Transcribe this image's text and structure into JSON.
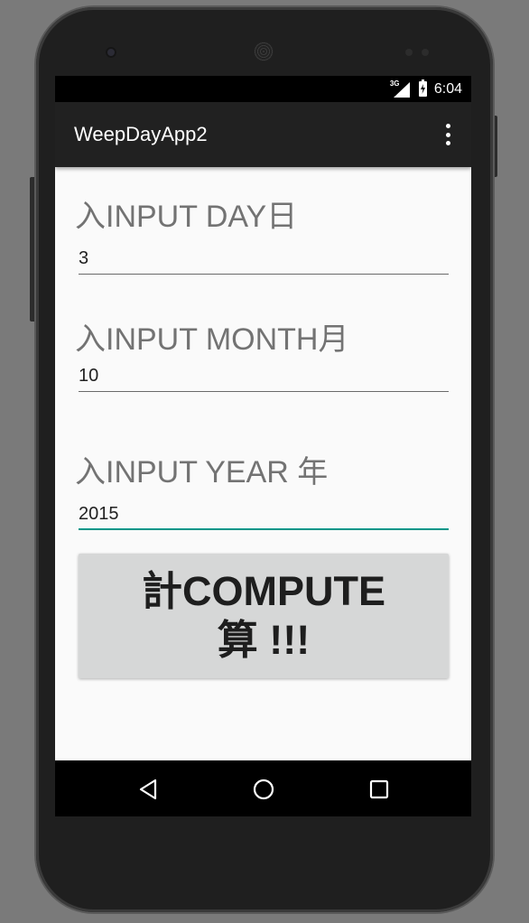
{
  "status_bar": {
    "network": "3G",
    "time": "6:04",
    "icons": [
      "signal-icon",
      "battery-charging-icon"
    ]
  },
  "app_bar": {
    "title": "WeepDayApp2",
    "overflow_icon": "more-vert-icon"
  },
  "form": {
    "day": {
      "label": "入INPUT DAY日",
      "value": "3"
    },
    "month": {
      "label": "入INPUT MONTH月",
      "value": "10"
    },
    "year": {
      "label": "入INPUT YEAR 年",
      "value": "2015"
    },
    "compute_label": "計COMPUTE\n算 !!!"
  },
  "nav_bar": {
    "items": [
      "back-icon",
      "home-icon",
      "recents-icon"
    ]
  },
  "colors": {
    "app_bar": "#212121",
    "focus_underline": "#009688",
    "button_bg": "#d6d7d7",
    "label_text": "#737373"
  }
}
